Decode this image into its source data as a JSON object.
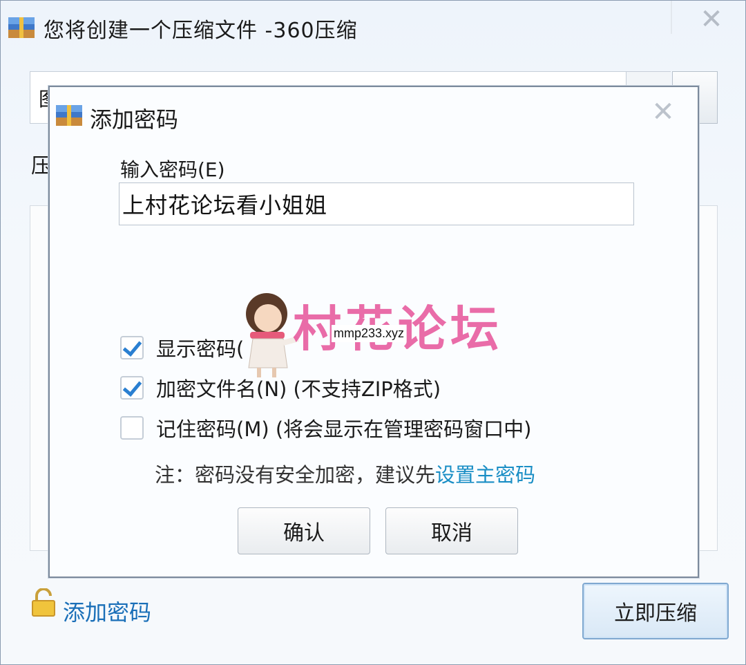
{
  "outer_window": {
    "title": "您将创建一个压缩文件 -360压缩",
    "path_prefix": "图",
    "compress_label": "压",
    "add_password_link": "添加密码",
    "compress_now_button": "立即压缩"
  },
  "dialog": {
    "title": "添加密码",
    "password_label": "输入密码(E)",
    "password_value": "上村花论坛看小姐姐",
    "options": [
      {
        "label": "显示密码(",
        "checked": true
      },
      {
        "label": "加密文件名(N) (不支持ZIP格式)",
        "checked": true
      },
      {
        "label": "记住密码(M) (将会显示在管理密码窗口中)",
        "checked": false
      }
    ],
    "note_text": "注：密码没有安全加密，建议先",
    "note_link": "设置主密码",
    "ok_button": "确认",
    "cancel_button": "取消"
  },
  "watermark": {
    "text": "村花论坛",
    "url": "mmp233.xyz"
  },
  "icons": {
    "app": "archive-icon",
    "close": "close-icon",
    "lock": "lock-icon"
  },
  "colors": {
    "link": "#1a6fb8",
    "checkbox_check": "#2a7fd1",
    "watermark": "#e6539a"
  }
}
